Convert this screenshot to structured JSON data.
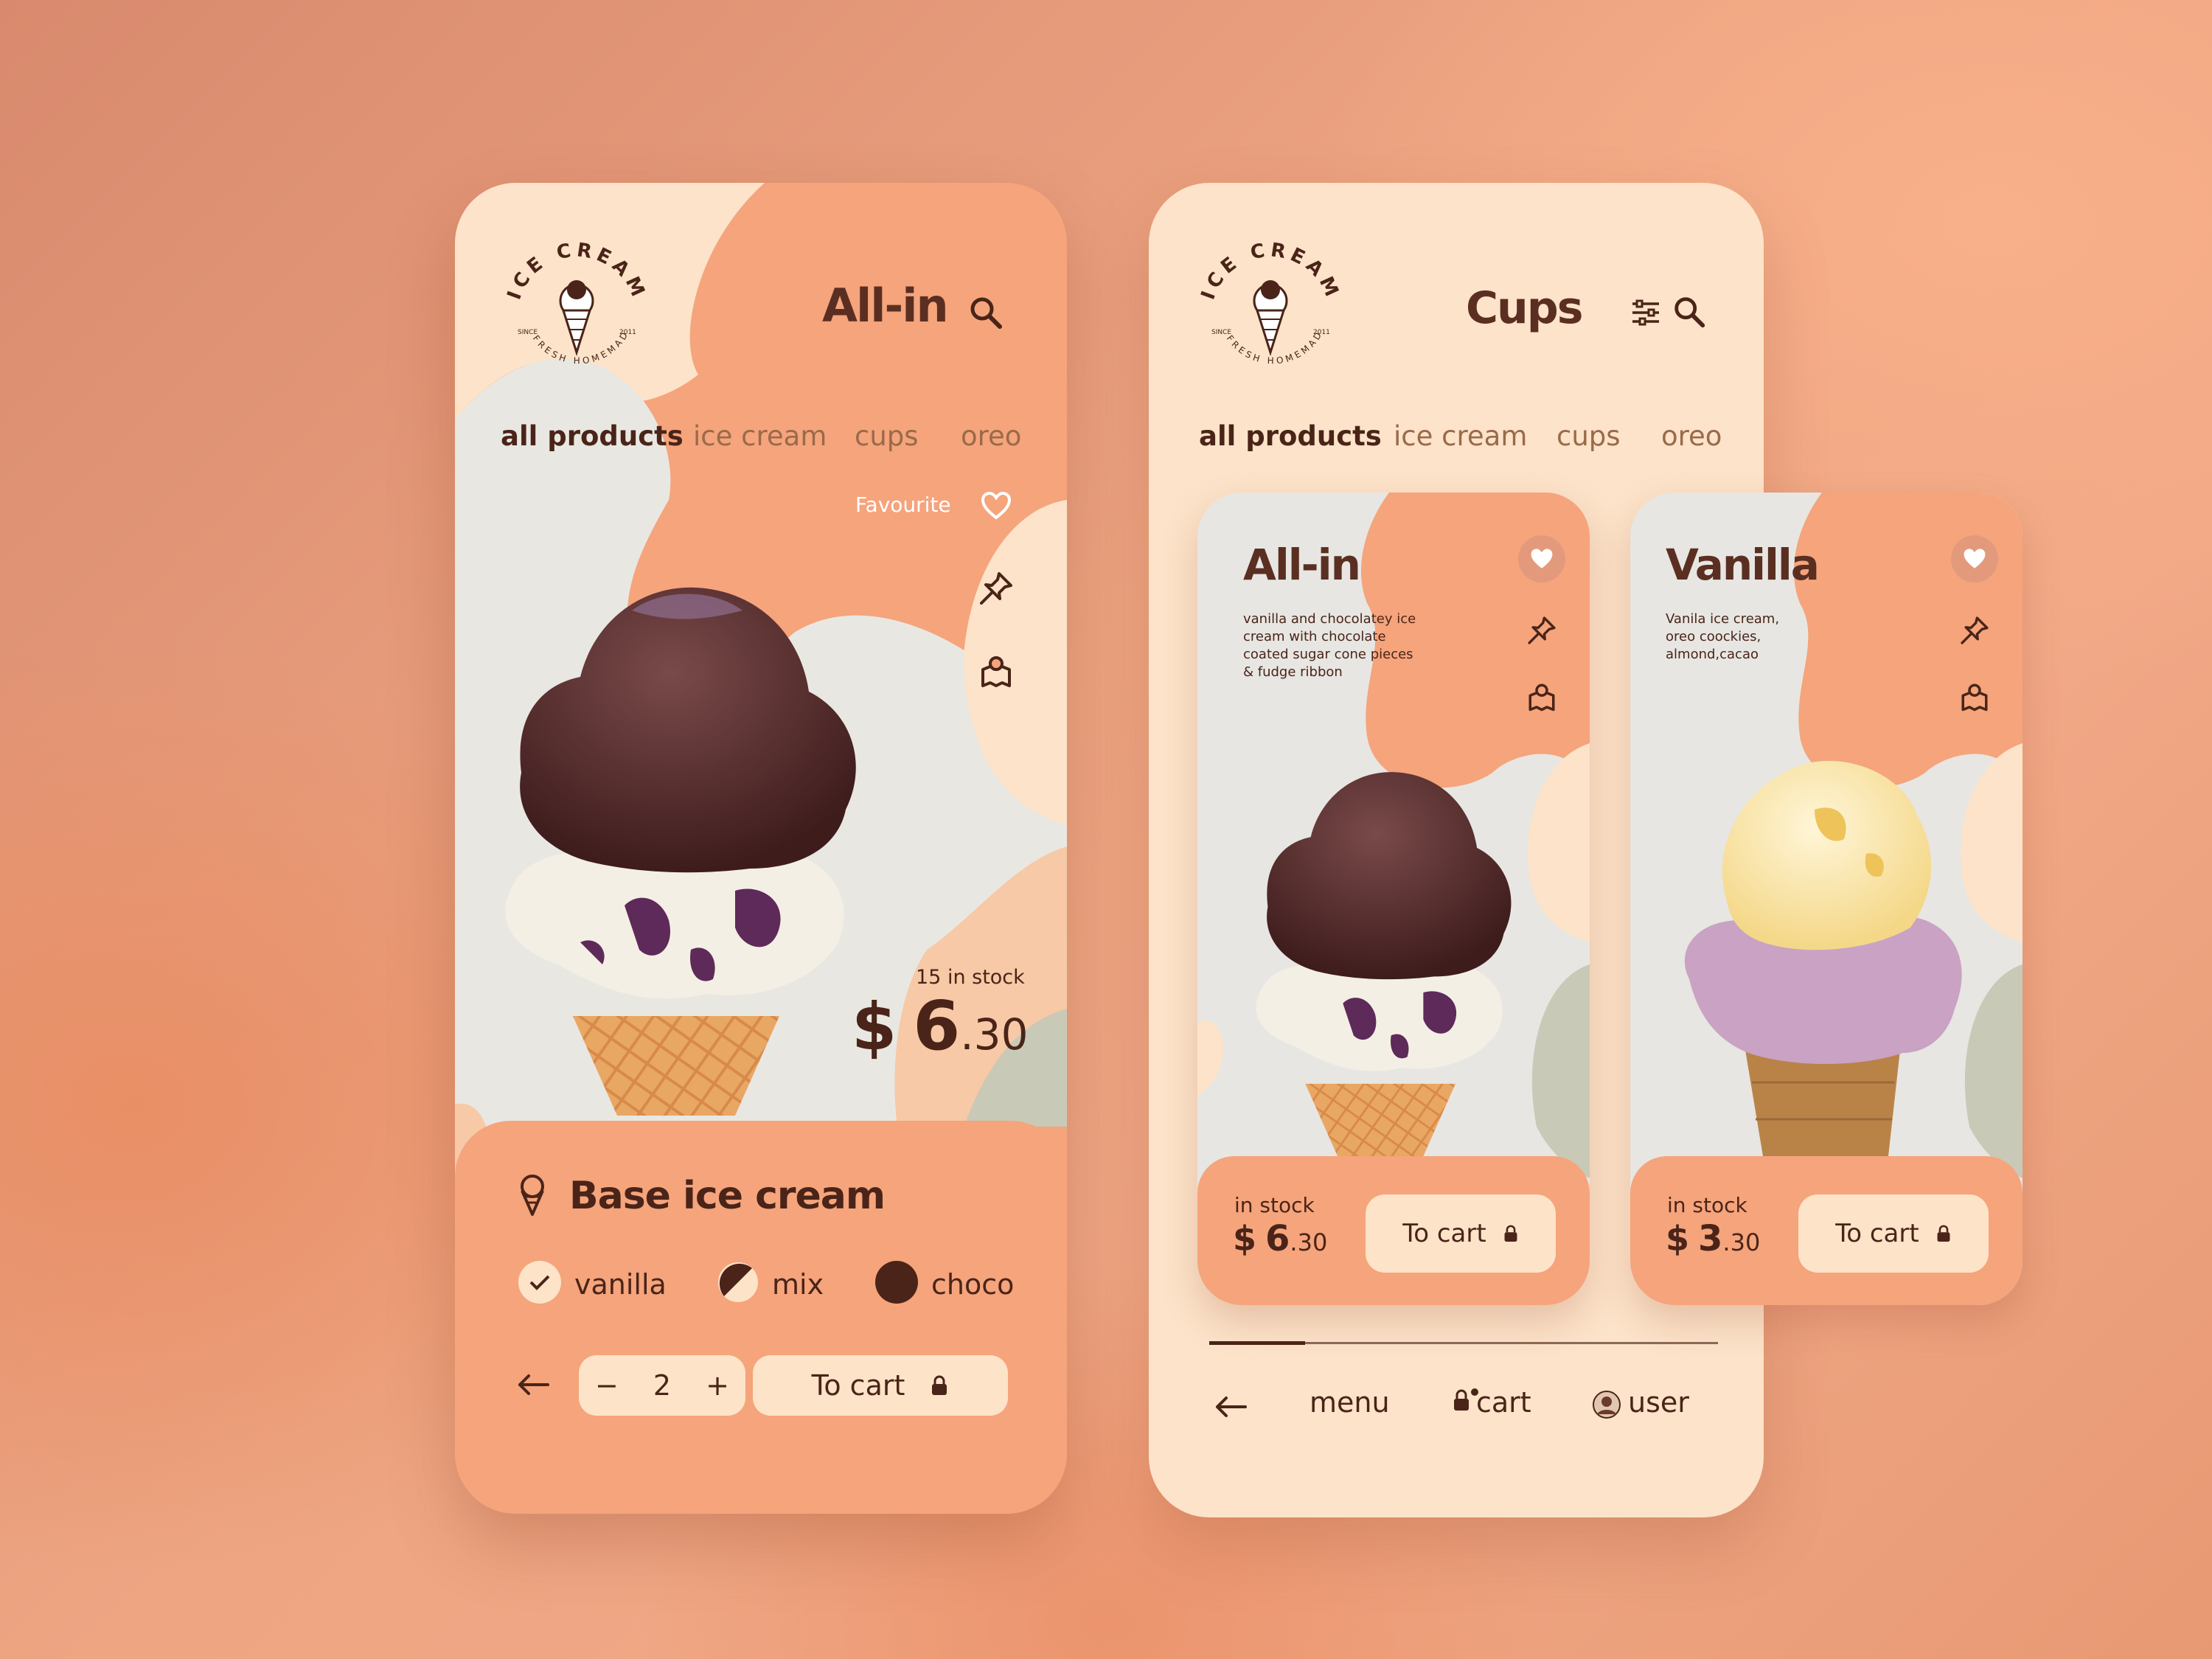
{
  "colors": {
    "peach": "#f5a47c",
    "cream": "#fce3c9",
    "dark": "#4a2418",
    "grey": "#e7e6e2",
    "sage": "#c9c9b7"
  },
  "logo": {
    "top_text": "ICE CREAM",
    "bottom_text": "FRESH HOMEMADE",
    "since": "SINCE",
    "year": "2011"
  },
  "screen1": {
    "title": "All-in",
    "tabs": [
      "all products",
      "ice cream",
      "cups",
      "oreo"
    ],
    "favourite_label": "Favourite",
    "stock": "15 in stock",
    "price_currency": "$",
    "price_main": "6",
    "price_cents": ".30",
    "section_title": "Base ice cream",
    "options": [
      {
        "label": "vanilla",
        "state": "checked"
      },
      {
        "label": "mix",
        "state": "half"
      },
      {
        "label": "choco",
        "state": "filled"
      }
    ],
    "quantity": "2",
    "minus": "−",
    "plus": "+",
    "cart_label": "To cart"
  },
  "screen2": {
    "title": "Cups",
    "tabs": [
      "all products",
      "ice cream",
      "cups",
      "oreo"
    ],
    "cards": [
      {
        "name": "All-in",
        "description": "vanilla and chocolatey ice cream with chocolate coated sugar cone pieces & fudge ribbon",
        "stock_label": "in stock",
        "price_currency": "$",
        "price_main": "6",
        "price_cents": ".30",
        "cart_label": "To cart"
      },
      {
        "name": "Vanilla",
        "description": "Vanila ice cream, oreo coockies, almond,cacao",
        "stock_label": "in stock",
        "price_currency": "$",
        "price_main": "3",
        "price_cents": ".30",
        "cart_label": "To cart"
      }
    ],
    "nav": {
      "menu": "menu",
      "cart": "cart",
      "user": "user"
    }
  },
  "icons": [
    "search-icon",
    "filter-icon",
    "heart-icon",
    "pin-icon",
    "map-icon",
    "cone-icon",
    "lock-icon",
    "arrow-left-icon",
    "avatar"
  ]
}
